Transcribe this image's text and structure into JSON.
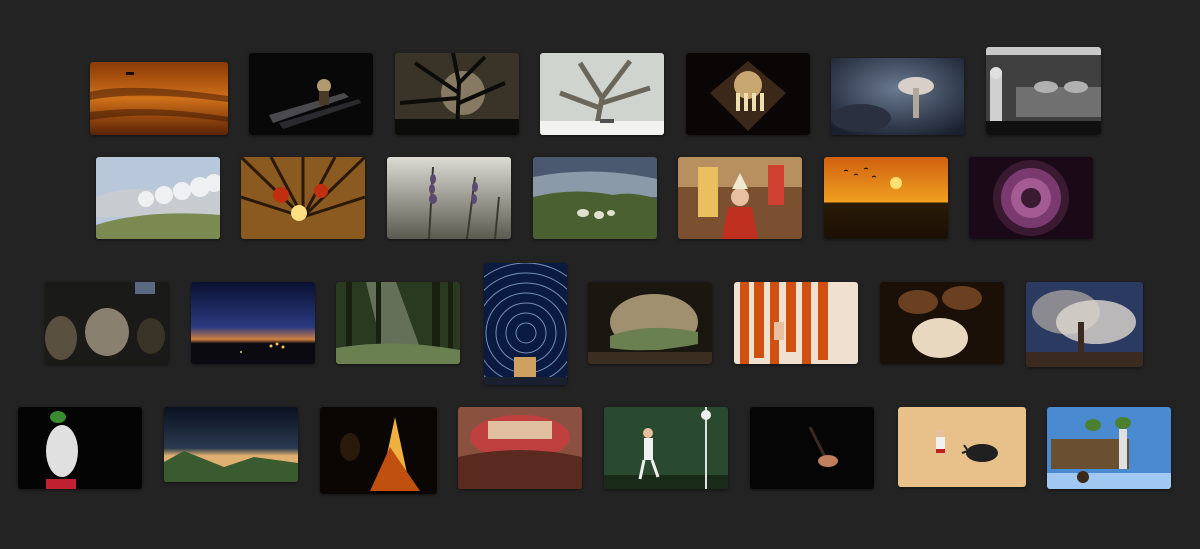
{
  "gallery": {
    "background_color": "#232323",
    "photos": [
      {
        "id": "photo-sunset-field",
        "row": 1,
        "colors": [
          "#6b2a05",
          "#c25a10",
          "#e08a2a",
          "#3a1602"
        ]
      },
      {
        "id": "photo-night-worker",
        "row": 1,
        "colors": [
          "#050505",
          "#1a1a1a",
          "#6a6a70",
          "#b0a080"
        ]
      },
      {
        "id": "photo-moon-tree",
        "row": 1,
        "colors": [
          "#2a2620",
          "#6b6352",
          "#a89a78",
          "#0c0c0a"
        ]
      },
      {
        "id": "photo-snowy-tree",
        "row": 1,
        "colors": [
          "#d8dcd8",
          "#a8b0a8",
          "#5c5a50",
          "#f2f2f0"
        ]
      },
      {
        "id": "photo-cathedral-dome",
        "row": 1,
        "colors": [
          "#0a0606",
          "#3c2818",
          "#c8a870",
          "#f0e0b0"
        ]
      },
      {
        "id": "photo-mushroom",
        "row": 1,
        "colors": [
          "#1a2030",
          "#4a5a70",
          "#c8c0b8",
          "#2a3040"
        ]
      },
      {
        "id": "photo-bw-workshop",
        "row": 1,
        "colors": [
          "#101010",
          "#707070",
          "#c8c8c8",
          "#404040"
        ]
      },
      {
        "id": "photo-frosted-orchard",
        "row": 2,
        "colors": [
          "#c8d4e0",
          "#e8ecf0",
          "#7a8a50",
          "#4a5a40"
        ]
      },
      {
        "id": "photo-forest-canopy",
        "row": 2,
        "colors": [
          "#4a2e10",
          "#c88a30",
          "#f0d070",
          "#2a1808"
        ]
      },
      {
        "id": "photo-lavender",
        "row": 2,
        "colors": [
          "#d0d0c8",
          "#9a9a90",
          "#5a4a70",
          "#3a3a30"
        ]
      },
      {
        "id": "photo-sheep-meadow",
        "row": 2,
        "colors": [
          "#4a5870",
          "#8a9aa8",
          "#4a6030",
          "#e0e0d0"
        ]
      },
      {
        "id": "photo-festival-crowd",
        "row": 2,
        "colors": [
          "#c03020",
          "#e8c060",
          "#7a5030",
          "#f0e8d0"
        ]
      },
      {
        "id": "photo-orange-sunset",
        "row": 2,
        "colors": [
          "#e07010",
          "#f0a020",
          "#2a1a08",
          "#ffe070"
        ]
      },
      {
        "id": "photo-purple-well",
        "row": 2,
        "colors": [
          "#1a0a18",
          "#7a3a70",
          "#c070a8",
          "#3a1a30"
        ]
      },
      {
        "id": "photo-sheep-barn",
        "row": 3,
        "colors": [
          "#1a1a18",
          "#5a5040",
          "#8a8070",
          "#2a2a28"
        ]
      },
      {
        "id": "photo-twilight-village",
        "row": 3,
        "colors": [
          "#0a1030",
          "#2a3a80",
          "#d08040",
          "#0a0a10"
        ]
      },
      {
        "id": "photo-sunbeam-forest",
        "row": 3,
        "colors": [
          "#2a3a20",
          "#6a8050",
          "#d0d8c0",
          "#1a2010"
        ]
      },
      {
        "id": "photo-star-trails",
        "row": 3,
        "colors": [
          "#0a1a40",
          "#3a5a90",
          "#d0a060",
          "#a0c0e0"
        ]
      },
      {
        "id": "photo-cave-window",
        "row": 3,
        "colors": [
          "#1a1610",
          "#5a4a30",
          "#a09070",
          "#6a8050"
        ]
      },
      {
        "id": "photo-red-peppers",
        "row": 3,
        "colors": [
          "#c04010",
          "#e87030",
          "#f0e0d0",
          "#8a2008"
        ]
      },
      {
        "id": "photo-bread-hands",
        "row": 3,
        "colors": [
          "#1a1008",
          "#6a4020",
          "#e8d8c0",
          "#3a2010"
        ]
      },
      {
        "id": "photo-smoke-factory",
        "row": 3,
        "colors": [
          "#2a3a60",
          "#8a8a90",
          "#e0d8d0",
          "#3a2a20"
        ]
      },
      {
        "id": "photo-masked-figure",
        "row": 4,
        "colors": [
          "#040404",
          "#e0e0e0",
          "#3a8a30",
          "#c02030"
        ]
      },
      {
        "id": "photo-mountain-night",
        "row": 4,
        "colors": [
          "#0a1020",
          "#2a3a50",
          "#e0b070",
          "#3a5a30"
        ]
      },
      {
        "id": "photo-bonfire",
        "row": 4,
        "colors": [
          "#0a0604",
          "#c05010",
          "#f0b040",
          "#2a1a0a"
        ]
      },
      {
        "id": "photo-bullring-crowd",
        "row": 4,
        "colors": [
          "#5a2a20",
          "#c04040",
          "#e0c0a0",
          "#8a5040"
        ]
      },
      {
        "id": "photo-pelota-player",
        "row": 4,
        "colors": [
          "#2a4a30",
          "#4a6a40",
          "#f0f0f0",
          "#1a2a18"
        ]
      },
      {
        "id": "photo-dark-hand",
        "row": 4,
        "colors": [
          "#050505",
          "#1a1010",
          "#c08060",
          "#3a2a20"
        ]
      },
      {
        "id": "photo-bullfight",
        "row": 4,
        "colors": [
          "#e0b070",
          "#f0d0a0",
          "#c02020",
          "#202020"
        ]
      },
      {
        "id": "photo-hay-cart",
        "row": 4,
        "colors": [
          "#4a8ad0",
          "#a0c8f0",
          "#6a5030",
          "#4a8030"
        ]
      }
    ]
  }
}
